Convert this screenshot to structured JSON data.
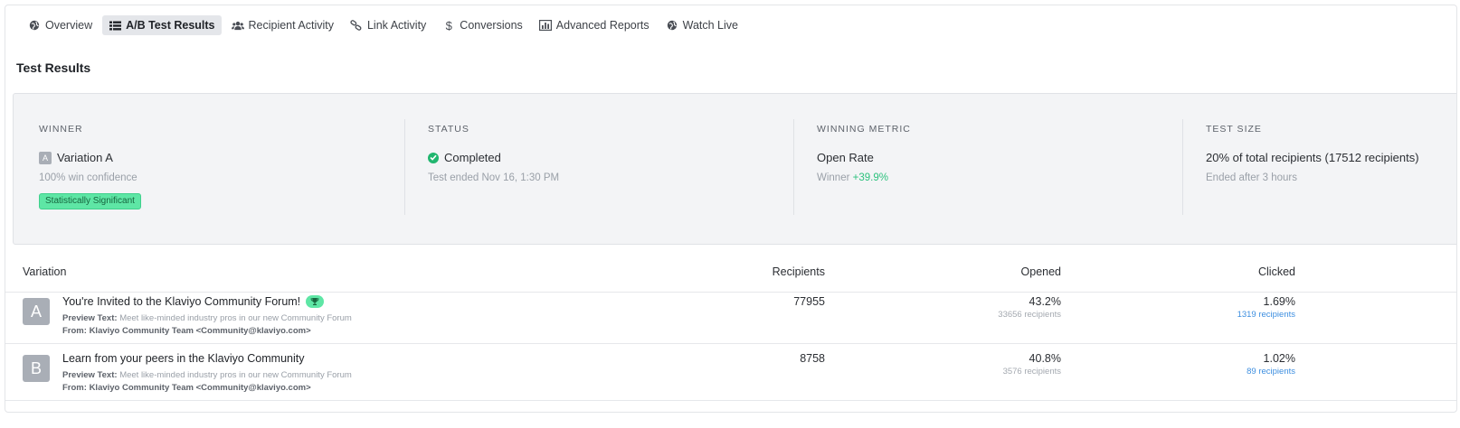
{
  "nav": {
    "items": [
      {
        "label": "Overview",
        "icon": "globe-icon"
      },
      {
        "label": "A/B Test Results",
        "icon": "list-icon",
        "active": true
      },
      {
        "label": "Recipient Activity",
        "icon": "users-icon"
      },
      {
        "label": "Link Activity",
        "icon": "link-icon"
      },
      {
        "label": "Conversions",
        "icon": "dollar-icon"
      },
      {
        "label": "Advanced Reports",
        "icon": "bar-chart-icon"
      },
      {
        "label": "Watch Live",
        "icon": "globe-icon"
      }
    ],
    "dollar_glyph": "$"
  },
  "page_title": "Test Results",
  "summary": {
    "winner": {
      "header": "WINNER",
      "chip": "A",
      "value": "Variation A",
      "sub": "100% win confidence",
      "badge": "Statistically Significant"
    },
    "status": {
      "header": "STATUS",
      "value": "Completed",
      "sub": "Test ended Nov 16, 1:30 PM"
    },
    "winning_metric": {
      "header": "WINNING METRIC",
      "value": "Open Rate",
      "sub_prefix": "Winner",
      "sub_delta": "+39.9%"
    },
    "test_size": {
      "header": "TEST SIZE",
      "value": "20% of total recipients (17512 recipients)",
      "sub": "Ended after 3 hours"
    }
  },
  "table": {
    "headers": {
      "variation": "Variation",
      "recipients": "Recipients",
      "opened": "Opened",
      "clicked": "Clicked"
    },
    "preview_label": "Preview Text:",
    "from_label": "From:",
    "rows": [
      {
        "letter": "A",
        "subject": "You're Invited to the Klaviyo Community Forum!",
        "winner": true,
        "preview": "Meet like-minded industry pros in our new Community Forum",
        "from": "Klaviyo Community Team <Community@klaviyo.com>",
        "recipients": "77955",
        "opened_rate": "43.2%",
        "opened_count": "33656 recipients",
        "clicked_rate": "1.69%",
        "clicked_count": "1319 recipients"
      },
      {
        "letter": "B",
        "subject": "Learn from your peers in the Klaviyo Community",
        "winner": false,
        "preview": "Meet like-minded industry pros in our new Community Forum",
        "from": "Klaviyo Community Team <Community@klaviyo.com>",
        "recipients": "8758",
        "opened_rate": "40.8%",
        "opened_count": "3576 recipients",
        "clicked_rate": "1.02%",
        "clicked_count": "89 recipients"
      }
    ]
  },
  "colors": {
    "accent_green": "#5ee6a5",
    "positive_text": "#2ec27e",
    "link_blue": "#3e8fe0",
    "active_tab_bg": "#e4e6ea"
  }
}
